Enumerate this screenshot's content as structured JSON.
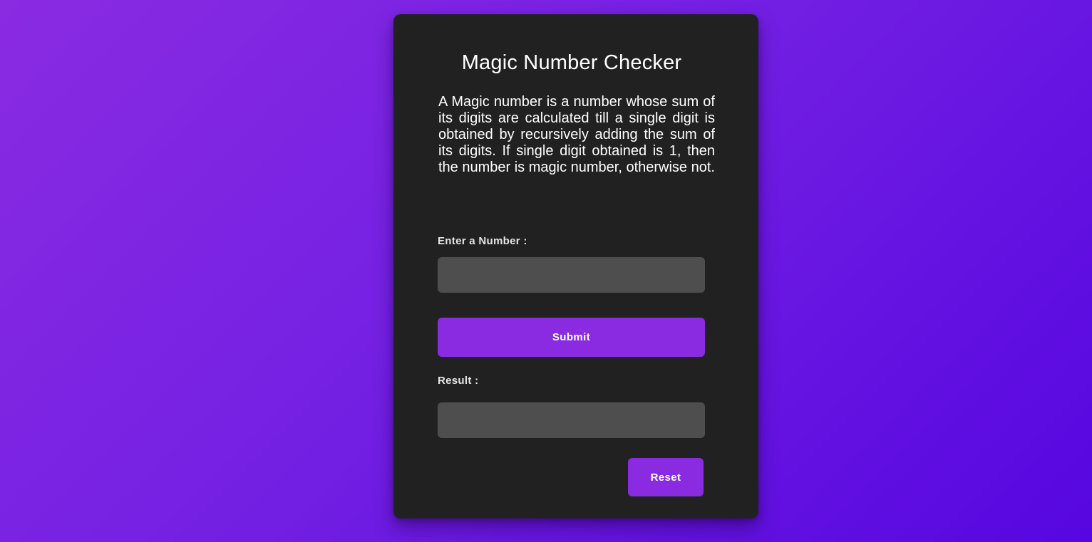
{
  "app": {
    "title": "Magic Number Checker",
    "description": "A Magic number is a number whose sum of its digits are calculated till a single digit is obtained by recursively adding the sum of its digits. If single digit obtained is 1, then the number is magic number, otherwise not."
  },
  "form": {
    "number_label": "Enter a Number :",
    "number_value": "",
    "submit_label": "Submit",
    "result_label": "Result :",
    "result_value": "",
    "reset_label": "Reset"
  },
  "colors": {
    "accent": "#8a2be2",
    "background_start": "#8a2be2",
    "background_end": "#5606e0",
    "card": "#212121",
    "field": "#4e4e4e",
    "text": "#ffffff"
  }
}
